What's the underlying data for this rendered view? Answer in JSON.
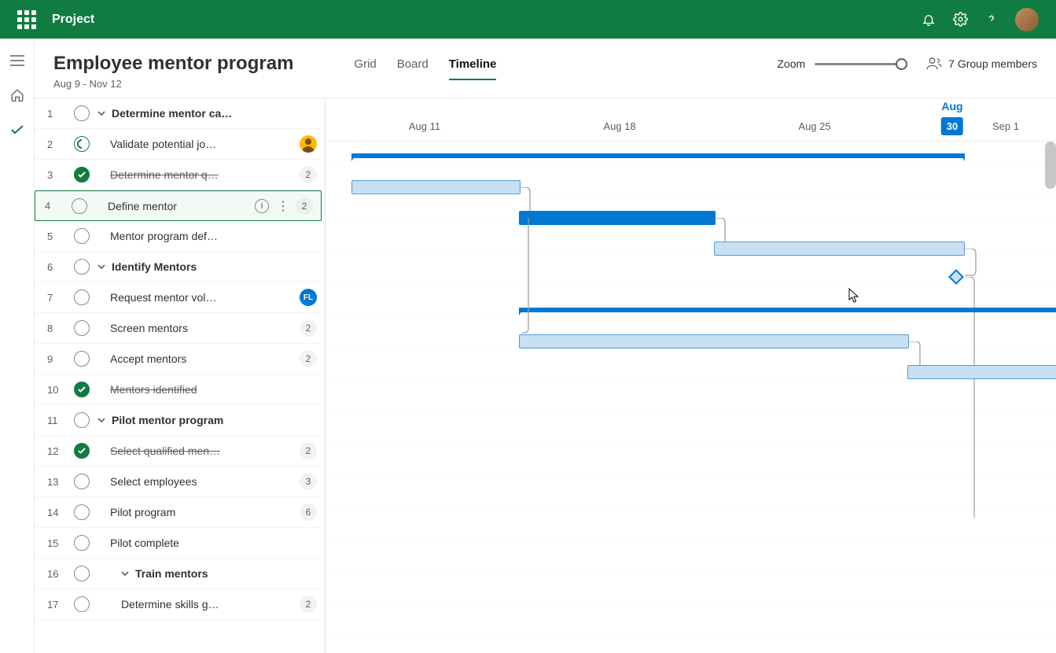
{
  "header": {
    "app_name": "Project"
  },
  "project": {
    "title": "Employee mentor program",
    "date_range": "Aug 9 - Nov 12"
  },
  "tabs": {
    "grid": "Grid",
    "board": "Board",
    "timeline": "Timeline"
  },
  "zoom_label": "Zoom",
  "members_label": "7 Group members",
  "timeline": {
    "month_current": "Aug",
    "current_day": "30",
    "ticks": [
      "Aug 11",
      "Aug 18",
      "Aug 25",
      "Sep 1"
    ]
  },
  "tasks": [
    {
      "n": "1",
      "name": "Determine mentor ca…",
      "status": "open",
      "group": true
    },
    {
      "n": "2",
      "name": "Validate potential jo…",
      "status": "progress",
      "avatar": true
    },
    {
      "n": "3",
      "name": "Determine mentor q…",
      "status": "done",
      "badge": "2"
    },
    {
      "n": "4",
      "name": "Define mentor",
      "status": "open",
      "badge": "2",
      "selected": true
    },
    {
      "n": "5",
      "name": "Mentor program def…",
      "status": "open"
    },
    {
      "n": "6",
      "name": "Identify Mentors",
      "status": "open",
      "group": true
    },
    {
      "n": "7",
      "name": "Request mentor vol…",
      "status": "open",
      "initials": "FL"
    },
    {
      "n": "8",
      "name": "Screen mentors",
      "status": "open",
      "badge": "2"
    },
    {
      "n": "9",
      "name": "Accept mentors",
      "status": "open",
      "badge": "2"
    },
    {
      "n": "10",
      "name": "Mentors identified",
      "status": "done"
    },
    {
      "n": "11",
      "name": "Pilot mentor program",
      "status": "open",
      "group": true
    },
    {
      "n": "12",
      "name": "Select qualified men…",
      "status": "done",
      "badge": "2"
    },
    {
      "n": "13",
      "name": "Select employees",
      "status": "open",
      "badge": "3"
    },
    {
      "n": "14",
      "name": "Pilot program",
      "status": "open",
      "badge": "6"
    },
    {
      "n": "15",
      "name": "Pilot complete",
      "status": "open"
    },
    {
      "n": "16",
      "name": "Train mentors",
      "status": "open",
      "group": true,
      "indent": 2
    },
    {
      "n": "17",
      "name": "Determine skills g…",
      "status": "open",
      "badge": "2",
      "indent": 2
    }
  ]
}
